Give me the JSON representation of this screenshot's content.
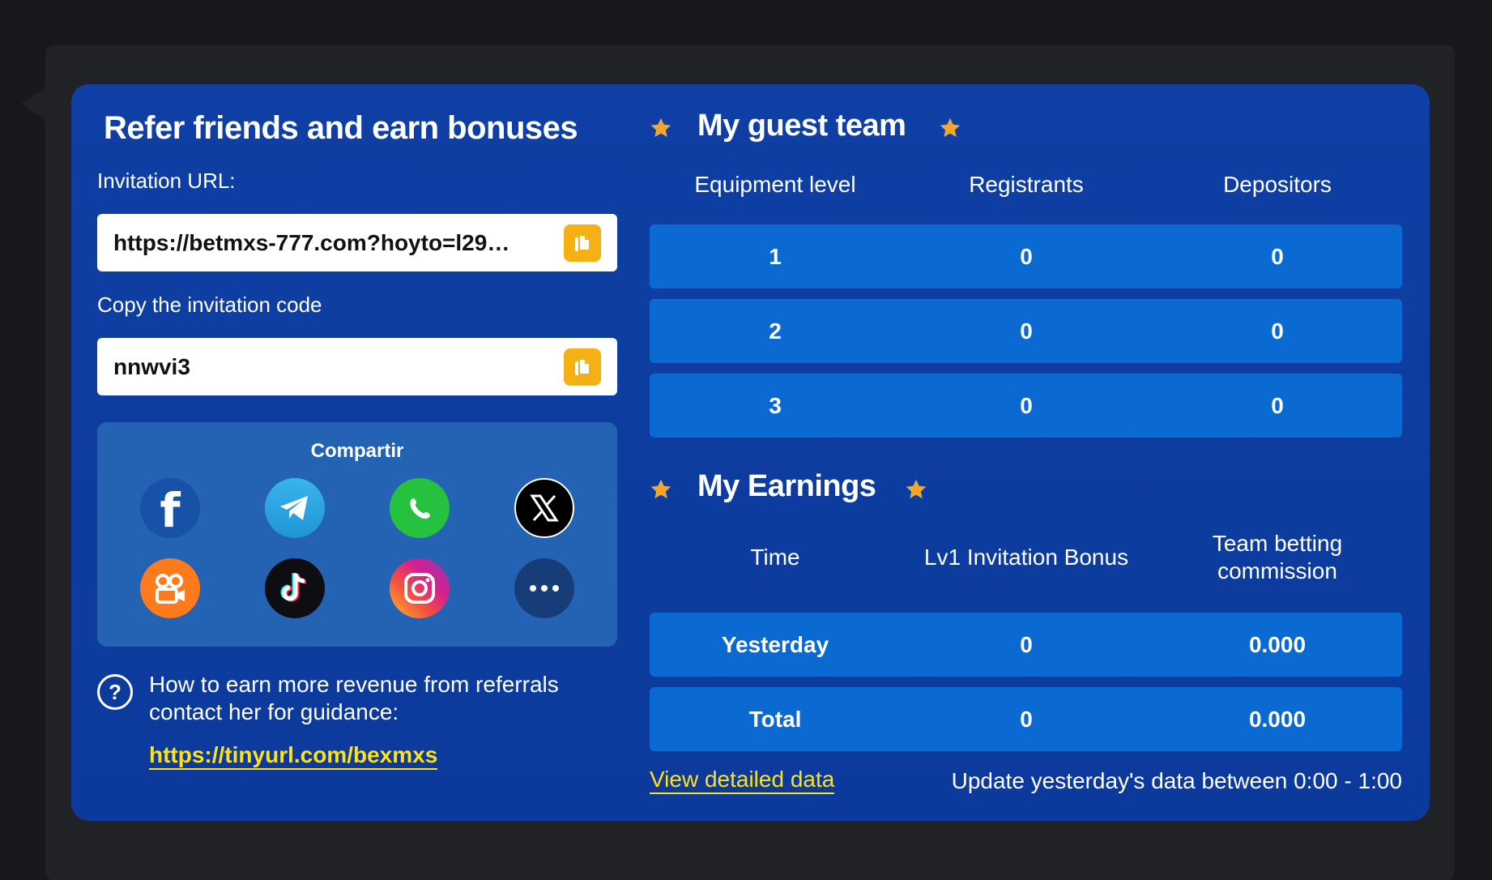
{
  "refer": {
    "title": "Refer friends and earn bonuses",
    "url_label": "Invitation URL:",
    "url_value": "https://betmxs-777.com?hoyto=l29…",
    "code_label": "Copy the invitation code",
    "code_value": "nnwvi3"
  },
  "share": {
    "title": "Compartir",
    "icons": [
      "facebook-icon",
      "telegram-icon",
      "whatsapp-icon",
      "x-icon",
      "kwai-icon",
      "tiktok-icon",
      "instagram-icon",
      "more-icon"
    ]
  },
  "help": {
    "text": "How to earn more revenue from referrals contact her for guidance:",
    "link": "https://tinyurl.com/bexmxs"
  },
  "team": {
    "title": "My guest team",
    "headers": [
      "Equipment level",
      "Registrants",
      "Depositors"
    ],
    "rows": [
      [
        "1",
        "0",
        "0"
      ],
      [
        "2",
        "0",
        "0"
      ],
      [
        "3",
        "0",
        "0"
      ]
    ]
  },
  "earnings": {
    "title": "My Earnings",
    "headers": [
      "Time",
      "Lv1 Invitation Bonus",
      "Team betting commission"
    ],
    "rows": [
      [
        "Yesterday",
        "0",
        "0.000"
      ],
      [
        "Total",
        "0",
        "0.000"
      ]
    ]
  },
  "footer": {
    "view_link": "View detailed data",
    "note": "Update yesterday's data between 0:00 - 1:00"
  },
  "colors": {
    "accent": "#f5b014",
    "link": "#ffe11a",
    "card_bg": "#0f3fa4",
    "row_bg": "#0a6ad2"
  }
}
